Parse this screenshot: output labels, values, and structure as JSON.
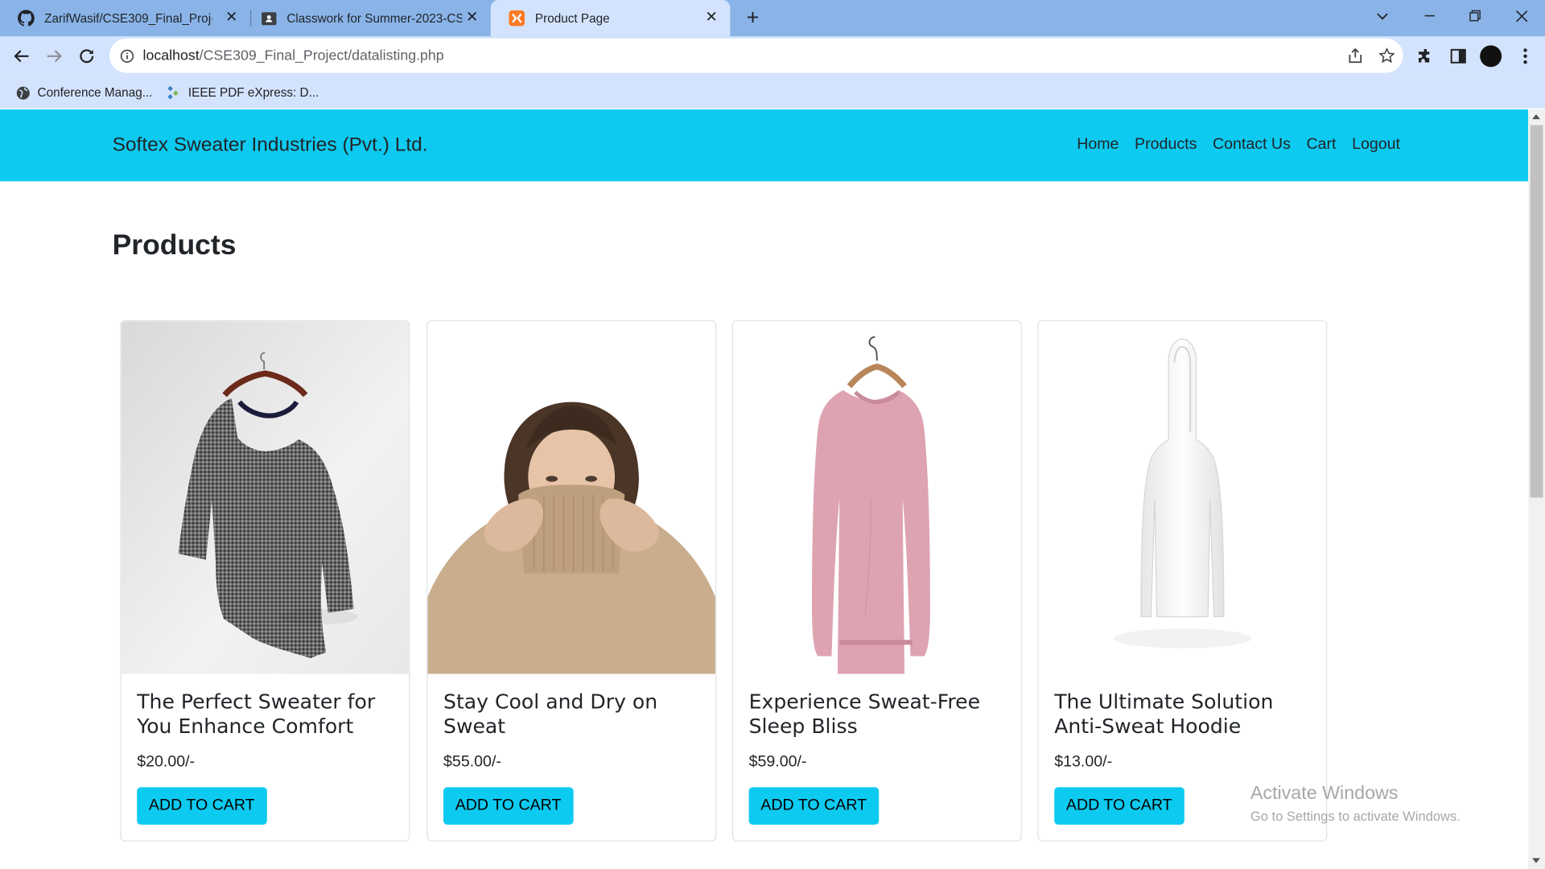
{
  "browser": {
    "tabs": [
      {
        "title": "ZarifWasif/CSE309_Final_Project",
        "icon": "github-icon"
      },
      {
        "title": "Classwork for Summer-2023-CSE",
        "icon": "classroom-icon"
      },
      {
        "title": "Product Page",
        "icon": "xampp-icon"
      }
    ],
    "url_host": "localhost",
    "url_path": "/CSE309_Final_Project/datalisting.php",
    "bookmarks": [
      {
        "label": "Conference Manag...",
        "icon": "globe-icon"
      },
      {
        "label": "IEEE PDF eXpress: D...",
        "icon": "ieee-icon"
      }
    ]
  },
  "navbar": {
    "brand": "Softex Sweater Industries (Pvt.) Ltd.",
    "links": [
      "Home",
      "Products",
      "Contact Us",
      "Cart",
      "Logout"
    ],
    "color": "#0dcaf0"
  },
  "page": {
    "title": "Products"
  },
  "products": [
    {
      "name": "The Perfect Sweater for You Enhance Comfort",
      "price": "$20.00/-",
      "button": "ADD TO CART"
    },
    {
      "name": "Stay Cool and Dry on Sweat",
      "price": "$55.00/-",
      "button": "ADD TO CART"
    },
    {
      "name": "Experience Sweat-Free Sleep Bliss",
      "price": "$59.00/-",
      "button": "ADD TO CART"
    },
    {
      "name": "The Ultimate Solution Anti-Sweat Hoodie",
      "price": "$13.00/-",
      "button": "ADD TO CART"
    }
  ],
  "watermark": {
    "line1": "Activate Windows",
    "line2": "Go to Settings to activate Windows."
  }
}
